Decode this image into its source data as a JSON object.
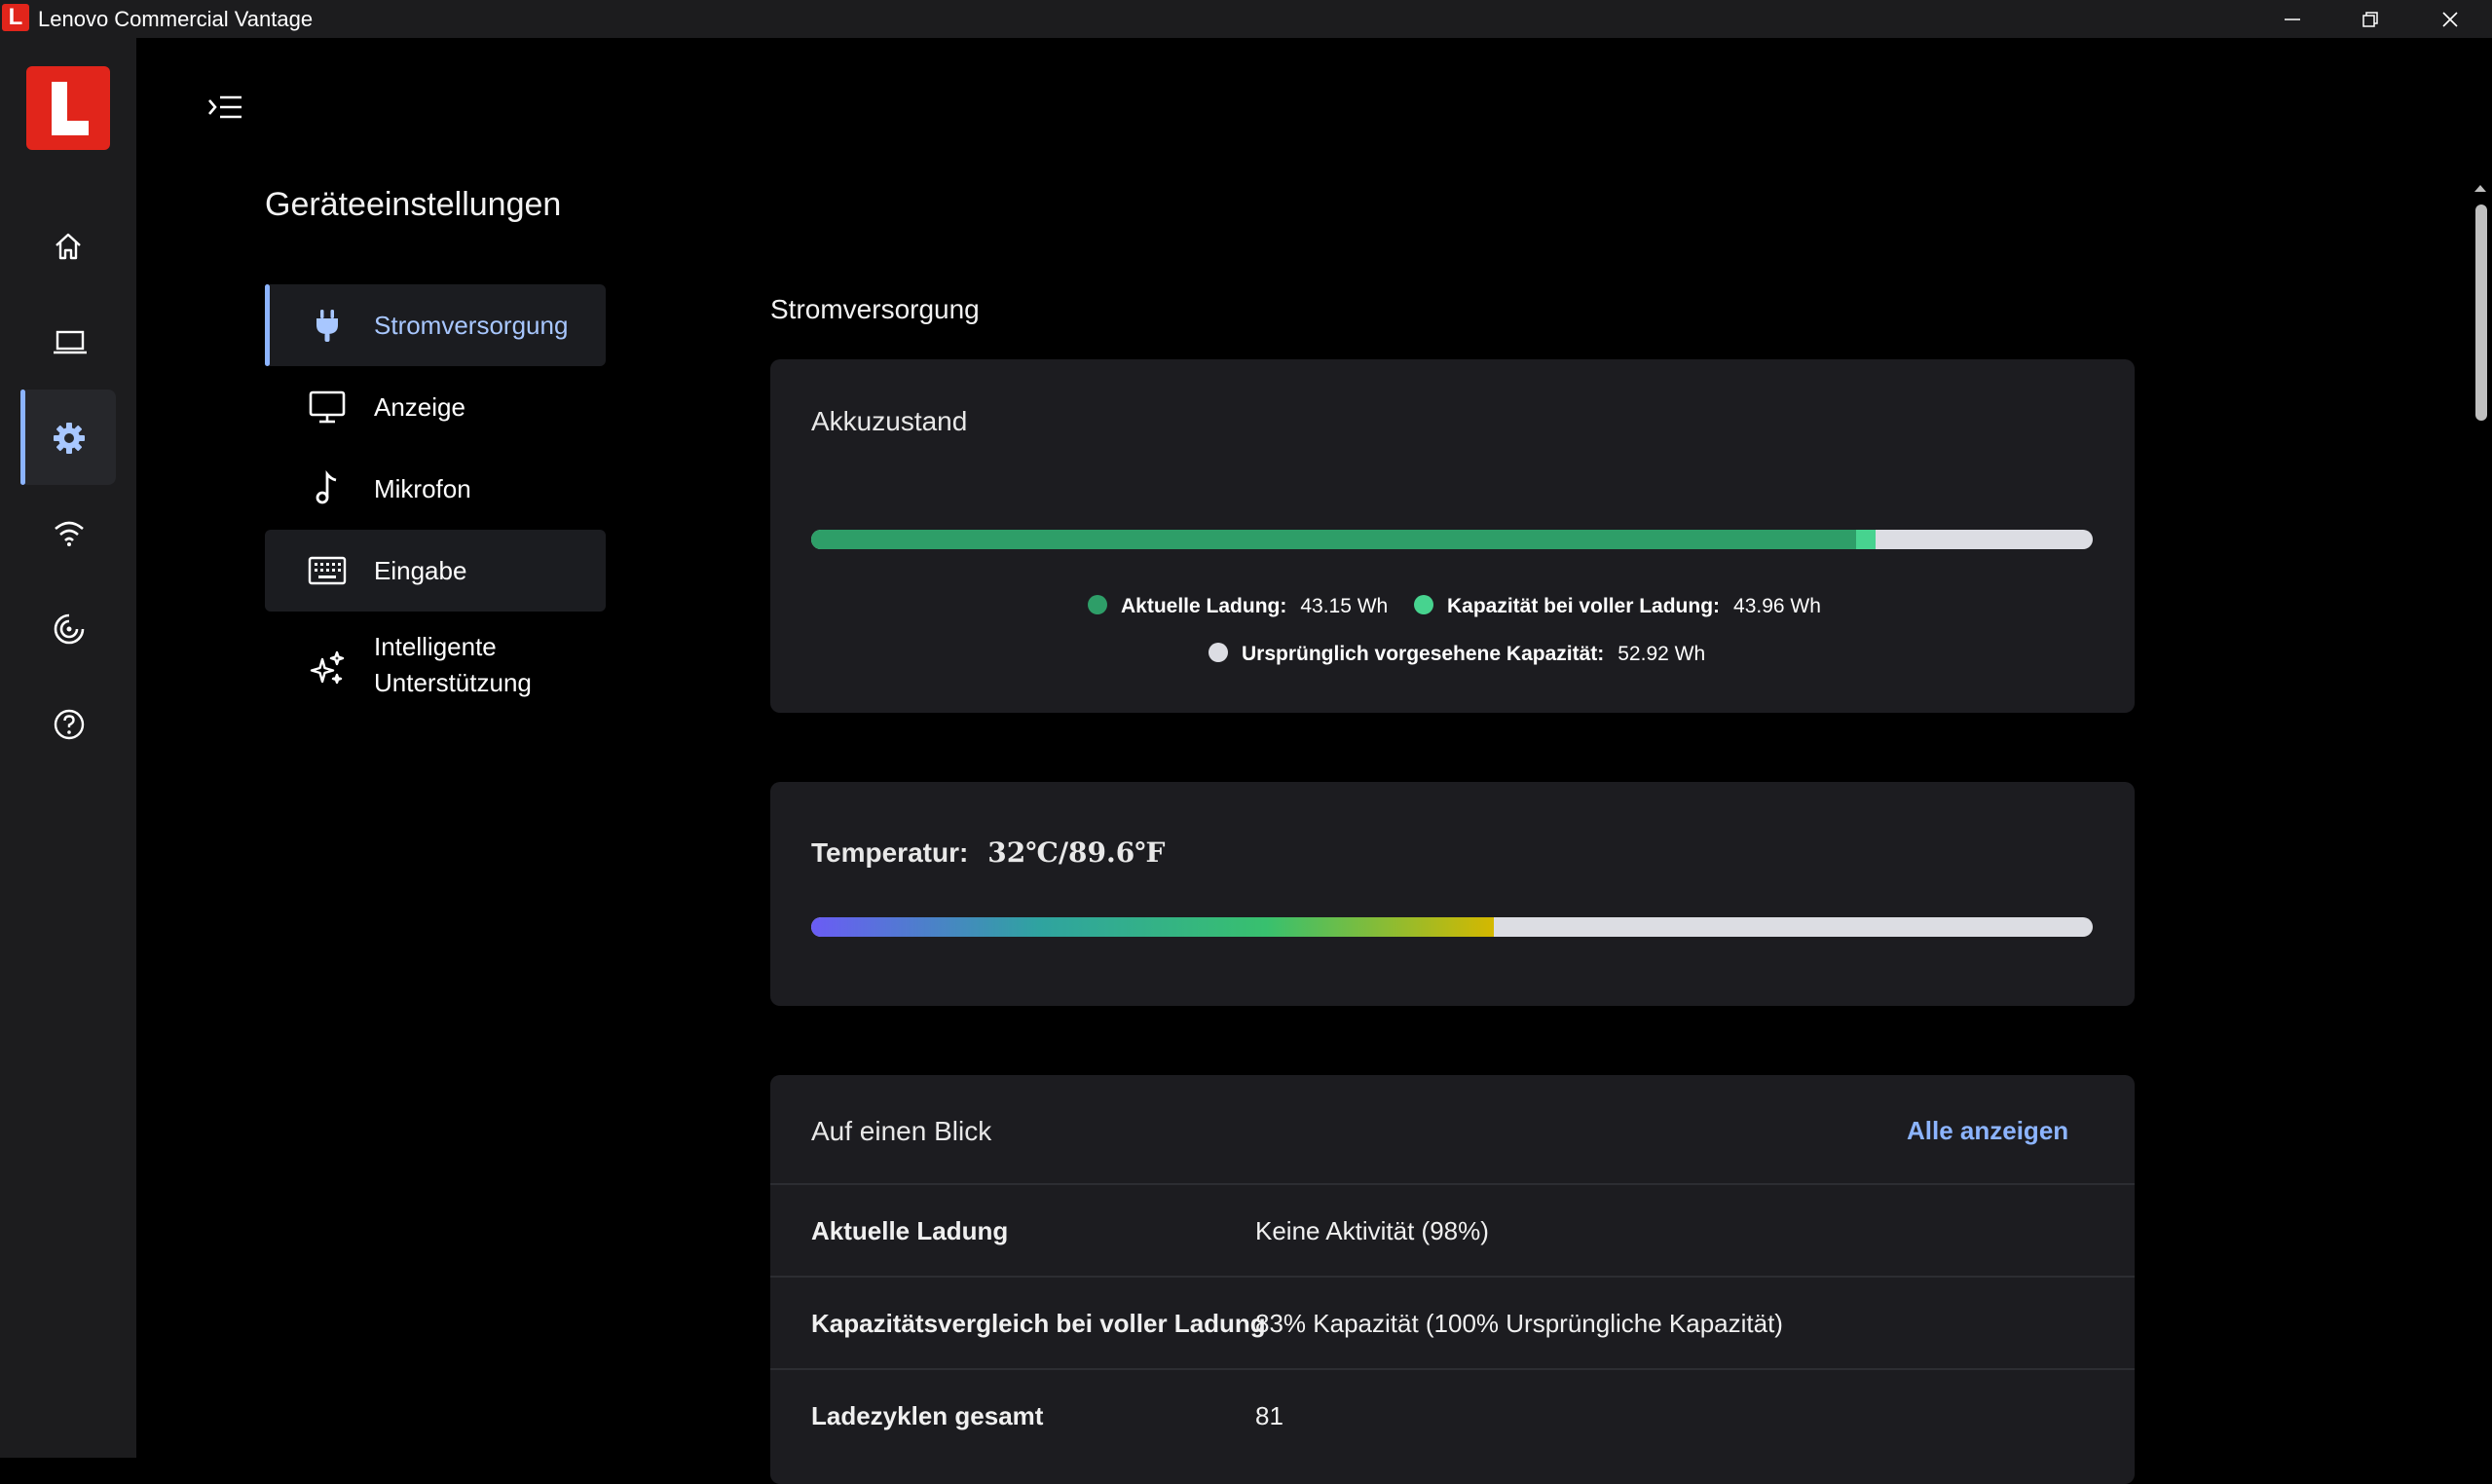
{
  "window": {
    "title": "Lenovo Commercial Vantage",
    "app_icon_letter": "L",
    "minimize_icon": "minimize-icon",
    "restore_icon": "restore-icon",
    "close_icon": "close-icon"
  },
  "rail": {
    "logo_letter": "L",
    "items": [
      {
        "icon": "home-icon"
      },
      {
        "icon": "laptop-icon"
      },
      {
        "icon": "gear-icon",
        "active": true
      },
      {
        "icon": "wifi-icon"
      },
      {
        "icon": "smart-performance-icon"
      },
      {
        "icon": "help-icon"
      }
    ]
  },
  "page": {
    "title": "Geräteeinstellungen",
    "menu_icon": "collapse-menu-icon"
  },
  "subnav": [
    {
      "label": "Stromversorgung",
      "icon": "plug-icon",
      "active": true
    },
    {
      "label": "Anzeige",
      "icon": "monitor-icon"
    },
    {
      "label": "Mikrofon",
      "icon": "music-note-icon"
    },
    {
      "label": "Eingabe",
      "icon": "keyboard-icon"
    },
    {
      "label_line1": "Intelligente",
      "label_line2": "Unterstützung",
      "icon": "sparkle-icon"
    }
  ],
  "section_title": "Stromversorgung",
  "battery": {
    "title": "Akkuzustand",
    "current_charge_label": "Aktuelle Ladung:",
    "current_charge_value": "43.15 Wh",
    "full_capacity_label": "Kapazität bei voller Ladung:",
    "full_capacity_value": "43.96 Wh",
    "design_capacity_label": "Ursprünglich vorgesehene Kapazität:",
    "design_capacity_value": "52.92 Wh",
    "colors": {
      "current": "#2e9e68",
      "full": "#47d38f",
      "design": "#dcdde3"
    },
    "current_fraction": 0.8154,
    "full_fraction": 0.8307
  },
  "temperature": {
    "label": "Temperatur:",
    "value": "32℃/89.6℉",
    "fill_fraction": 0.533,
    "gradient": [
      "#6a5cf5",
      "#2fa3a0",
      "#38c06e",
      "#d4b800"
    ]
  },
  "glance": {
    "title": "Auf einen Blick",
    "show_all": "Alle anzeigen",
    "rows": [
      {
        "key": "Aktuelle Ladung",
        "value": "Keine Aktivität (98%)"
      },
      {
        "key": "Kapazitätsvergleich bei voller Ladung",
        "value": "83% Kapazität (100% Ursprüngliche Kapazität)"
      },
      {
        "key": "Ladezyklen gesamt",
        "value": "81"
      }
    ]
  }
}
